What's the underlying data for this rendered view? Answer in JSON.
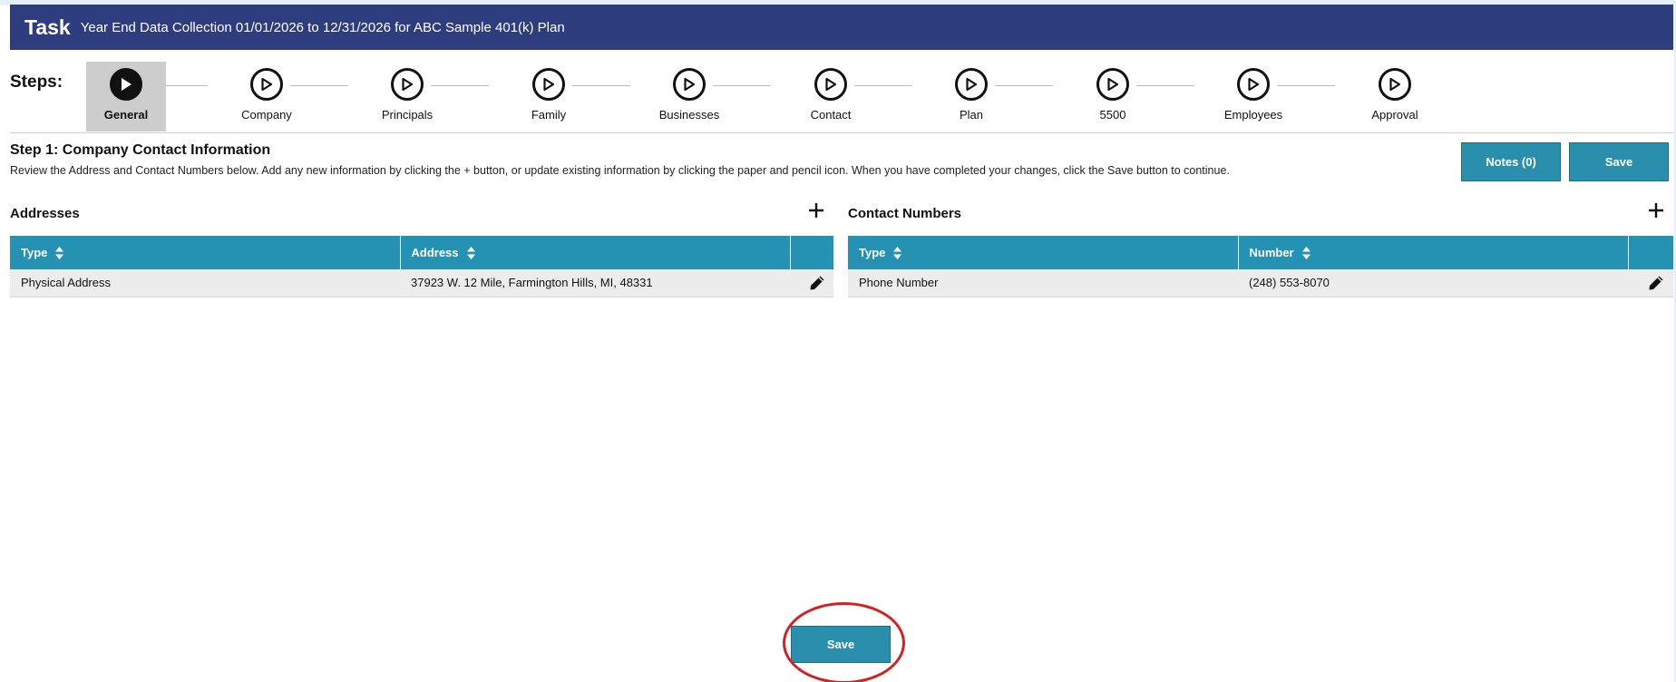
{
  "header": {
    "task_word": "Task",
    "task_title": "Year End Data Collection 01/01/2026 to 12/31/2026 for ABC Sample 401(k) Plan"
  },
  "steps": {
    "label": "Steps:",
    "items": [
      {
        "label": "General",
        "active": true
      },
      {
        "label": "Company"
      },
      {
        "label": "Principals"
      },
      {
        "label": "Family"
      },
      {
        "label": "Businesses"
      },
      {
        "label": "Contact"
      },
      {
        "label": "Plan"
      },
      {
        "label": "5500"
      },
      {
        "label": "Employees"
      },
      {
        "label": "Approval"
      }
    ]
  },
  "step_info": {
    "heading": "Step 1: Company Contact Information",
    "instructions": "Review the Address and Contact Numbers below. Add any new information by clicking the + button, or update existing information by clicking the paper and pencil icon. When you have completed your changes, click the Save button to continue."
  },
  "buttons": {
    "notes": "Notes (0)",
    "save_top": "Save",
    "save_bottom": "Save"
  },
  "addresses": {
    "title": "Addresses",
    "columns": [
      "Type",
      "Address"
    ],
    "rows": [
      {
        "type": "Physical Address",
        "value": "37923 W. 12 Mile, Farmington Hills, MI, 48331"
      }
    ]
  },
  "contact_numbers": {
    "title": "Contact Numbers",
    "columns": [
      "Type",
      "Number"
    ],
    "rows": [
      {
        "type": "Phone Number",
        "value": "(248) 553-8070"
      }
    ]
  },
  "colors": {
    "header_bg": "#2e3d7e",
    "table_header_bg": "#2591b3",
    "button_bg": "#2a8fad",
    "highlight": "#d42020"
  },
  "icons": {
    "step": "play-circle-icon",
    "add": "plus-icon",
    "sort": "sort-icon",
    "edit": "pencil-icon"
  }
}
